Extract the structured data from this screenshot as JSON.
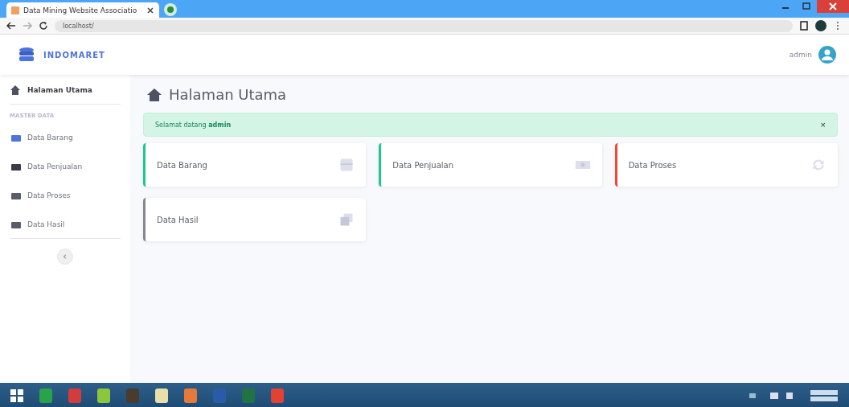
{
  "browser": {
    "tab_title": "Data Mining Website Associatio",
    "address": "localhost/"
  },
  "header": {
    "brand": "INDOMARET",
    "user": "admin"
  },
  "sidebar": {
    "items": [
      {
        "label": "Halaman Utama",
        "selected": true
      }
    ],
    "section": "MASTER DATA",
    "menu": [
      {
        "label": "Data Barang",
        "selected": false
      },
      {
        "label": "Data Penjualan",
        "selected": false
      },
      {
        "label": "Data Proses",
        "selected": false
      },
      {
        "label": "Data Hasil",
        "selected": false
      }
    ]
  },
  "page": {
    "title": "Halaman Utama",
    "alert": "Selamat datang **admin**",
    "alert_close": "×",
    "cards": [
      {
        "label": "Data Barang",
        "color": "#1cc88a",
        "kind": "box"
      },
      {
        "label": "Data Penjualan",
        "color": "#1cc88a",
        "kind": "money"
      },
      {
        "label": "Data Proses",
        "color": "#e74a3b",
        "kind": "sync"
      },
      {
        "label": "Data Hasil",
        "color": "#858796",
        "kind": "copy"
      }
    ]
  }
}
